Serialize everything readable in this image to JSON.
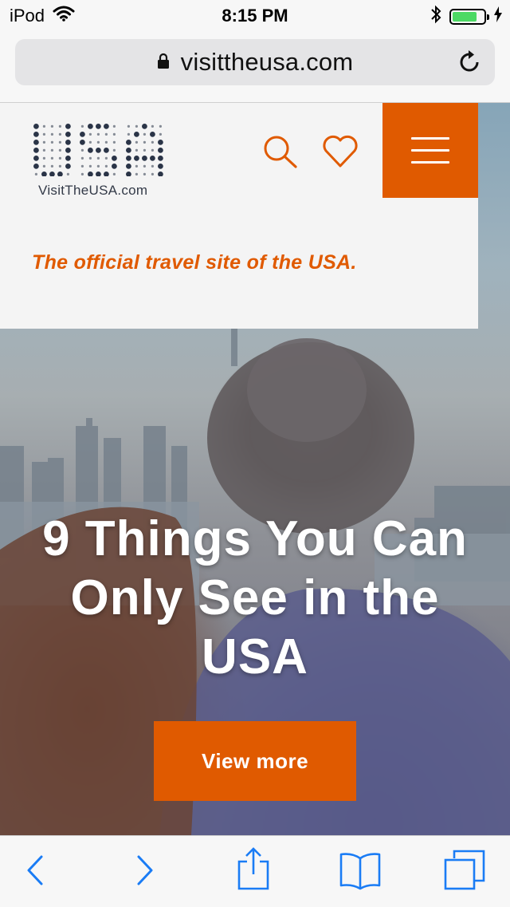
{
  "status_bar": {
    "carrier": "iPod",
    "time": "8:15 PM",
    "battery_level": 0.8,
    "icons": [
      "wifi-icon",
      "bluetooth-icon",
      "battery-icon",
      "charging-icon"
    ]
  },
  "browser": {
    "url": "visittheusa.com",
    "icons": [
      "lock-icon",
      "reload-icon"
    ]
  },
  "site_header": {
    "logo_text": "USA",
    "logo_subtext": "VisitTheUSA.com",
    "tagline": "The official travel site of the USA.",
    "icons": [
      "search-icon",
      "heart-icon",
      "hamburger-menu-icon"
    ]
  },
  "hero": {
    "title": "9 Things You Can Only See in the USA",
    "button_label": "View more"
  },
  "toolbar": {
    "icons": [
      "back-icon",
      "forward-icon",
      "share-icon",
      "bookmarks-icon",
      "tabs-icon"
    ]
  },
  "colors": {
    "brand_orange": "#e05a00",
    "ios_blue": "#1a7cf5",
    "logo_navy": "#2a3447"
  }
}
